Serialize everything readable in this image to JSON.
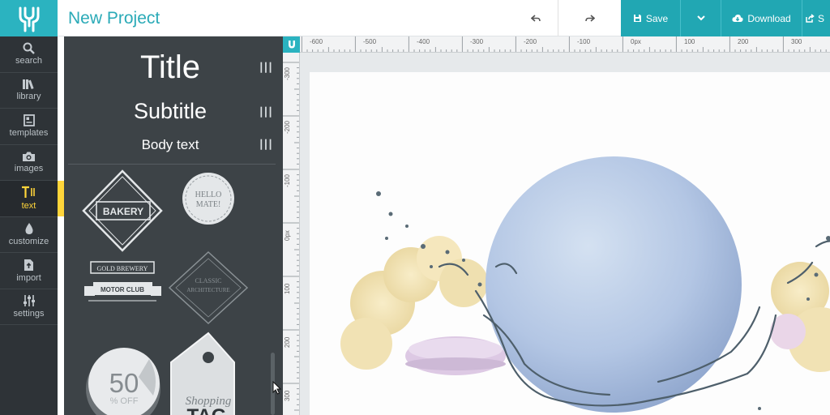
{
  "header": {
    "project_title": "New Project",
    "save_label": "Save",
    "download_label": "Download",
    "share_label": "S",
    "logo_icon": "bird-logo-icon",
    "accent_color": "#21a7b3"
  },
  "nav": {
    "items": [
      {
        "label": "search",
        "icon": "search-icon"
      },
      {
        "label": "library",
        "icon": "books-icon"
      },
      {
        "label": "templates",
        "icon": "template-icon"
      },
      {
        "label": "images",
        "icon": "camera-icon"
      },
      {
        "label": "text",
        "icon": "text-icon",
        "active": true
      },
      {
        "label": "customize",
        "icon": "droplet-icon"
      },
      {
        "label": "import",
        "icon": "file-upload-icon"
      },
      {
        "label": "settings",
        "icon": "sliders-icon"
      }
    ],
    "active_color": "#ffd53a"
  },
  "panel": {
    "title_text": "Title",
    "subtitle_text": "Subtitle",
    "body_text": "Body text",
    "badges": {
      "bakery": "BAKERY",
      "hello_line1": "HELLO",
      "hello_line2": "MATE!",
      "gold_brewery": "GOLD BREWERY",
      "motor_club": "MOTOR CLUB",
      "classic": "CLASSIC",
      "architecture": "ARCHITECTURE",
      "sale_number": "50",
      "sale_off": "% OFF",
      "tag_script": "Shopping",
      "tag_caps": "TAG"
    }
  },
  "ruler": {
    "h_labels": [
      "-600",
      "-500",
      "-400",
      "-300",
      "-200",
      "-100",
      "0px",
      "100",
      "200",
      "300"
    ],
    "v_labels": [
      "-300",
      "-200",
      "-100",
      "0px",
      "100",
      "200",
      "300"
    ]
  }
}
